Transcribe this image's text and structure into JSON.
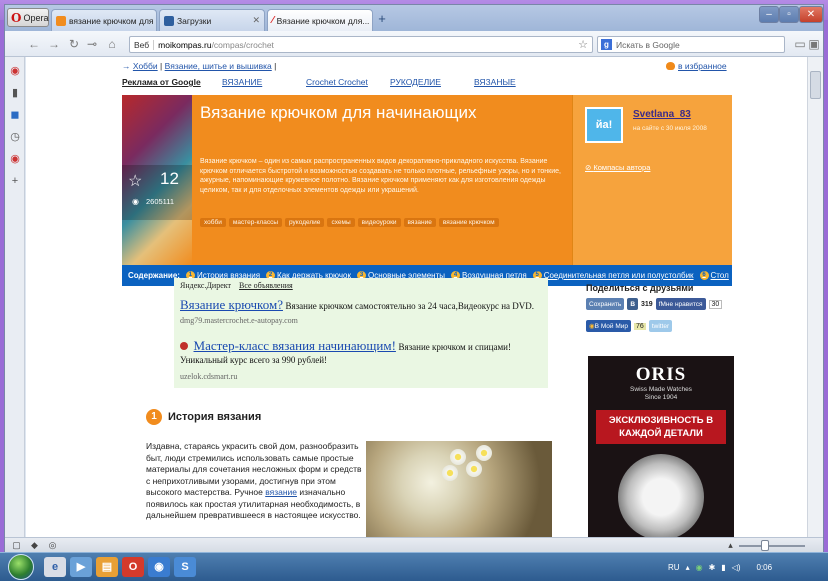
{
  "browser": {
    "app_button": "Opera",
    "tabs": [
      {
        "label": "вязание крючком для ..."
      },
      {
        "label": "Загрузки"
      },
      {
        "label": "Вязание крючком для..."
      }
    ],
    "address": {
      "scheme_label": "Веб",
      "domain": "moikompas.ru",
      "path": "/compas/crochet"
    },
    "search_placeholder": "Искать в Google"
  },
  "page": {
    "breadcrumb": {
      "root": "Хобби",
      "sep": "|",
      "current": "Вязание, шитье и вышивка",
      "sep2": "|"
    },
    "favorites": "в избранное",
    "topnav": [
      "Реклама от Google",
      "ВЯЗАНИЕ",
      "Crochet Crochet",
      "РУКОДЕЛИЕ",
      "ВЯЗАНЫЕ"
    ],
    "banner": {
      "title": "Вязание крючком для начинающих",
      "rating": "12",
      "views": "2605111",
      "description": "Вязание крючком – один из самых распространенных видов декоративно-прикладного искусства. Вязание крючком отличается быстротой и возможностью создавать не только плотные, рельефные узоры, но и тонкие, ажурные, напоминающие кружевное полотно. Вязание крючком применяют как для изготовления одежды целиком, так и для отделочных элементов одежды или украшений.",
      "tags": [
        "хобби",
        "мастер-классы",
        "рукоделие",
        "схемы",
        "видеоуроки",
        "вязание",
        "вязание крючком"
      ]
    },
    "author": {
      "avatar": "йа!",
      "name": "Svetlana_83",
      "since": "на сайте с 30 июля 2008",
      "link": "Компасы автора"
    },
    "toc": {
      "label": "Содержание:",
      "items": [
        "История вязания",
        "Как держать крючок",
        "Основные элементы",
        "Воздушная петля",
        "Соединительная петля или полустолбик",
        "Стол"
      ]
    },
    "ads": {
      "header": "Яндекс.Директ",
      "all_link": "Все объявления",
      "ad1": {
        "title": "Вязание крючком?",
        "desc": "Вязание крючком самостоятельно за 24 часа,Видеокурс на DVD.",
        "url": "dmg79.mastercrochet.e-autopay.com"
      },
      "ad2": {
        "title": "Мастер-класс вязания начинающим!",
        "desc": "Вязание крючком и спицами!",
        "line2": "Уникальный курс всего за 990 рублей!",
        "url": "uzelok.cdsmart.ru"
      }
    },
    "section": {
      "num": "1",
      "title": "История вязания",
      "text_before": "Издавна, стараясь украсить свой дом, разнообразить быт, люди стремились использовать самые простые материалы для сочетания несложных форм и средств с неприхотливыми узорами, достигнув при этом высокого мастерства. Ручное ",
      "text_link": "вязание",
      "text_after": " изначально появилось как простая утилитарная необходимость, в дальнейшем превратившееся в настоящее искусство."
    },
    "share": {
      "title": "Поделиться с друзьями",
      "vk": "Сохранить",
      "vk_badge": "В",
      "vk_count": "319",
      "fb": "Мне нравится",
      "fb_count": "30",
      "mm": "В Мой Мир",
      "mm_count": "76",
      "tw": "twitter"
    },
    "ad_oris": {
      "logo": "ORIS",
      "sub1": "Swiss Made Watches",
      "sub2": "Since 1904",
      "headline": "ЭКСКЛЮЗИВНОСТЬ В КАЖДОЙ ДЕТАЛИ"
    }
  },
  "taskbar": {
    "lang": "RU",
    "time": "0:06"
  }
}
